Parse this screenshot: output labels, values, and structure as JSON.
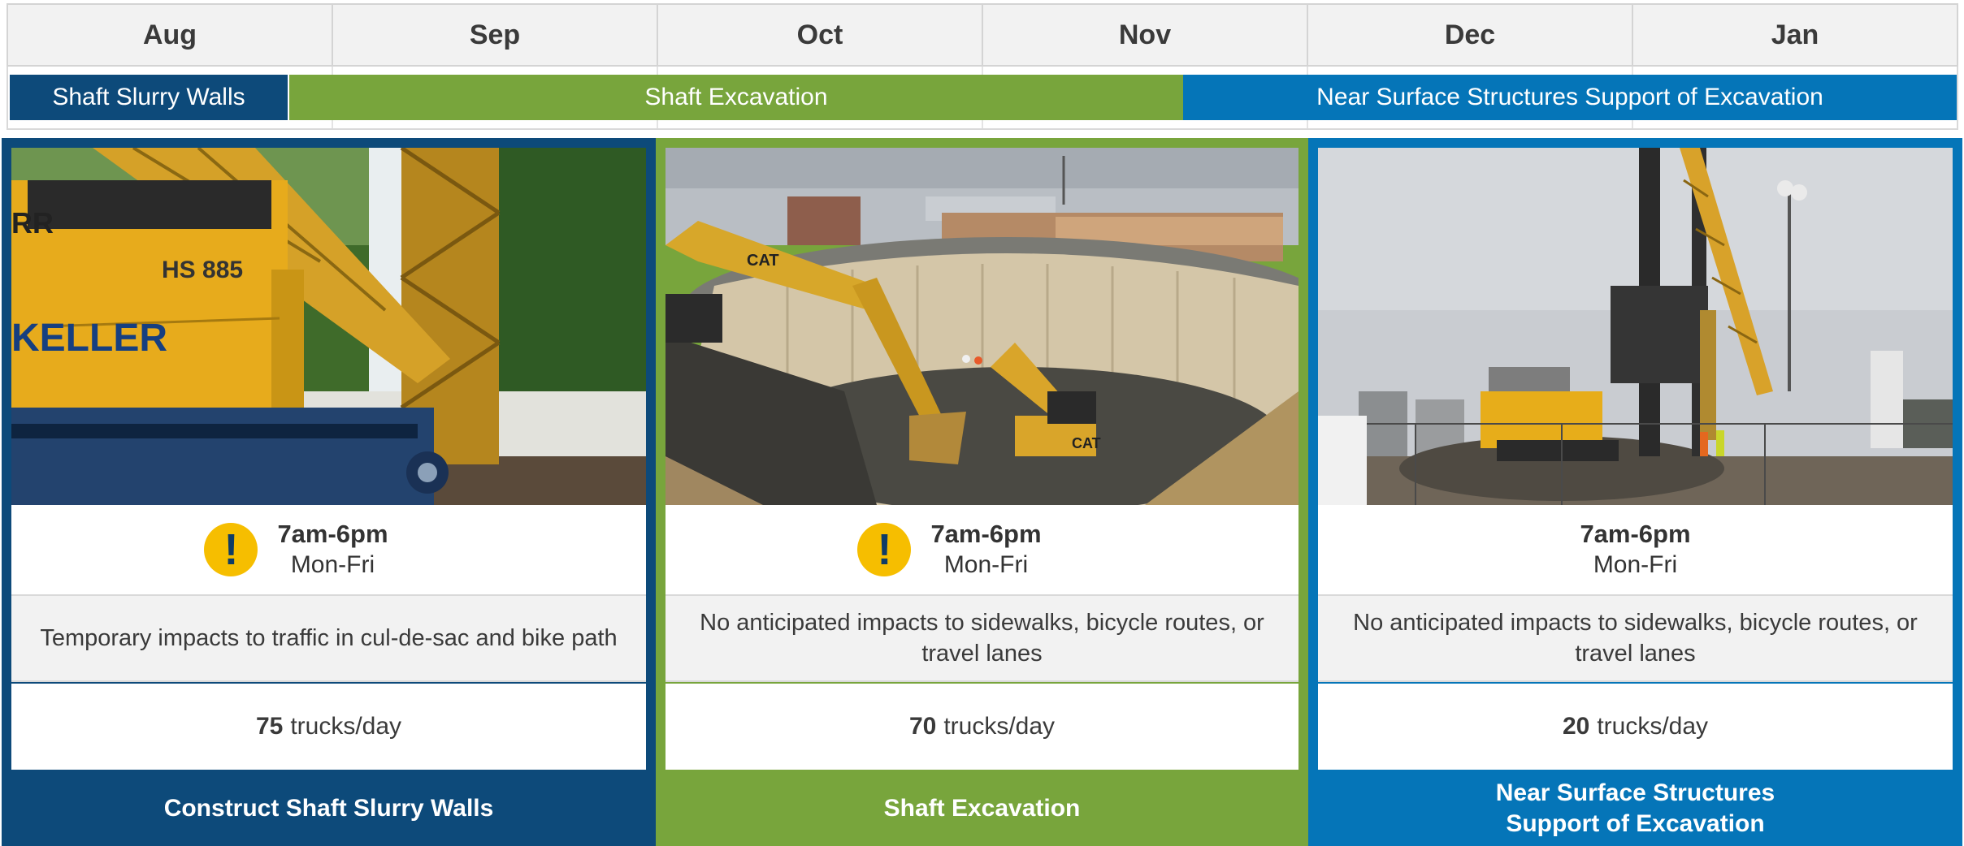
{
  "months": [
    "Aug",
    "Sep",
    "Oct",
    "Nov",
    "Dec",
    "Jan"
  ],
  "gantt": [
    {
      "label": "Shaft Slurry Walls",
      "color": "#0d4a7a"
    },
    {
      "label": "Shaft Excavation",
      "color": "#78a53c"
    },
    {
      "label": "Near Surface Structures Support of Excavation",
      "color": "#0575b8"
    }
  ],
  "cards": [
    {
      "color": "#0d4a7a",
      "photo_alt": "slurry-wall-rig",
      "show_alert": true,
      "hours": "7am-6pm",
      "days": "Mon-Fri",
      "impacts": "Temporary impacts to traffic in cul-de-sac and bike path",
      "trucks_count": "75",
      "trucks_unit": "trucks/day",
      "title": "Construct Shaft Slurry Walls"
    },
    {
      "color": "#78a53c",
      "photo_alt": "shaft-excavation",
      "show_alert": true,
      "hours": "7am-6pm",
      "days": "Mon-Fri",
      "impacts": "No anticipated impacts to sidewalks, bicycle routes, or travel lanes",
      "trucks_count": "70",
      "trucks_unit": "trucks/day",
      "title": "Shaft Excavation"
    },
    {
      "color": "#0575b8",
      "photo_alt": "pile-driving-rig",
      "show_alert": false,
      "hours": "7am-6pm",
      "days": "Mon-Fri",
      "impacts": "No anticipated impacts to sidewalks, bicycle routes, or travel lanes",
      "trucks_count": "20",
      "trucks_unit": "trucks/day",
      "title_line1": "Near Surface Structures",
      "title_line2": "Support of Excavation"
    }
  ],
  "photo_text": {
    "rig_brand": "KELLER",
    "rig_model": "HS 885",
    "rig_partial": "RR",
    "cat_logo": "CAT"
  }
}
